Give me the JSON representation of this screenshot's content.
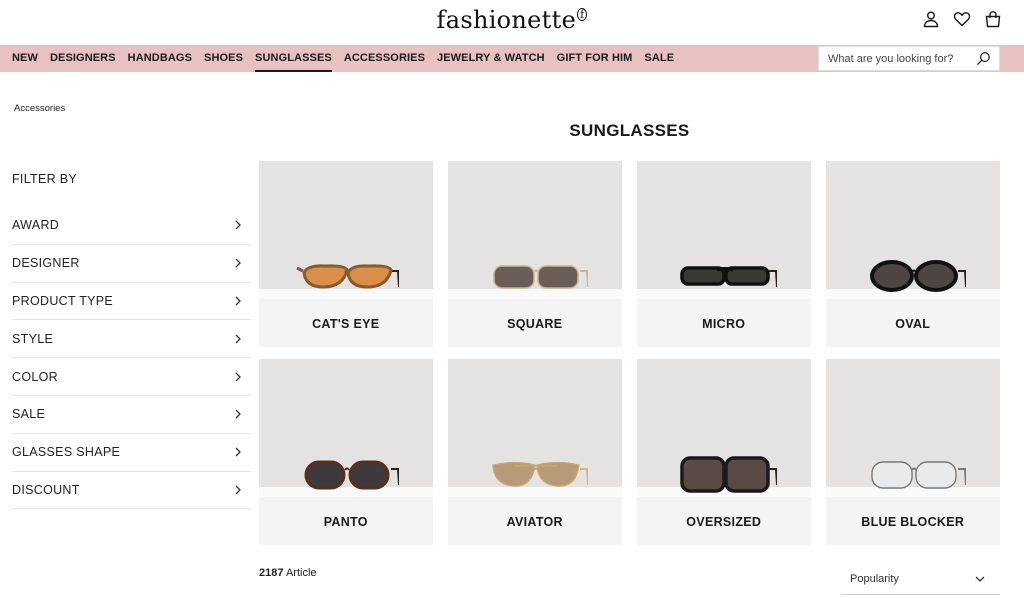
{
  "brand": {
    "name": "fashionette",
    "reg_mark": "f"
  },
  "header": {
    "icons": [
      "user-icon",
      "heart-icon",
      "shopping-bag-icon"
    ]
  },
  "nav": {
    "items": [
      {
        "label": "NEW",
        "active": false
      },
      {
        "label": "DESIGNERS",
        "active": false
      },
      {
        "label": "HANDBAGS",
        "active": false
      },
      {
        "label": "SHOES",
        "active": false
      },
      {
        "label": "SUNGLASSES",
        "active": true
      },
      {
        "label": "ACCESSORIES",
        "active": false
      },
      {
        "label": "JEWELRY & WATCH",
        "active": false
      },
      {
        "label": "GIFT FOR HIM",
        "active": false
      },
      {
        "label": "SALE",
        "active": false
      }
    ],
    "search": {
      "placeholder": "What are you looking for?",
      "value": "",
      "icon": "search-icon"
    }
  },
  "breadcrumb": {
    "items": [
      "Accessories"
    ]
  },
  "page": {
    "title": "SUNGLASSES"
  },
  "filters": {
    "title": "FILTER BY",
    "items": [
      "AWARD",
      "DESIGNER",
      "PRODUCT TYPE",
      "STYLE",
      "COLOR",
      "SALE",
      "GLASSES SHAPE",
      "DISCOUNT"
    ]
  },
  "categories": [
    {
      "label": "CAT'S EYE",
      "style": "cateye"
    },
    {
      "label": "SQUARE",
      "style": "square"
    },
    {
      "label": "MICRO",
      "style": "micro"
    },
    {
      "label": "OVAL",
      "style": "oval"
    },
    {
      "label": "PANTO",
      "style": "panto"
    },
    {
      "label": "AVIATOR",
      "style": "aviator"
    },
    {
      "label": "OVERSIZED",
      "style": "oversized"
    },
    {
      "label": "BLUE BLOCKER",
      "style": "blueblocker"
    }
  ],
  "results": {
    "count": "2187",
    "unit": "Article"
  },
  "sort": {
    "selected": "Popularity"
  },
  "colors": {
    "nav_background": "#e8c1c3",
    "card_photo_background": "#e4e3e2",
    "card_label_background": "#f4f4f4"
  }
}
